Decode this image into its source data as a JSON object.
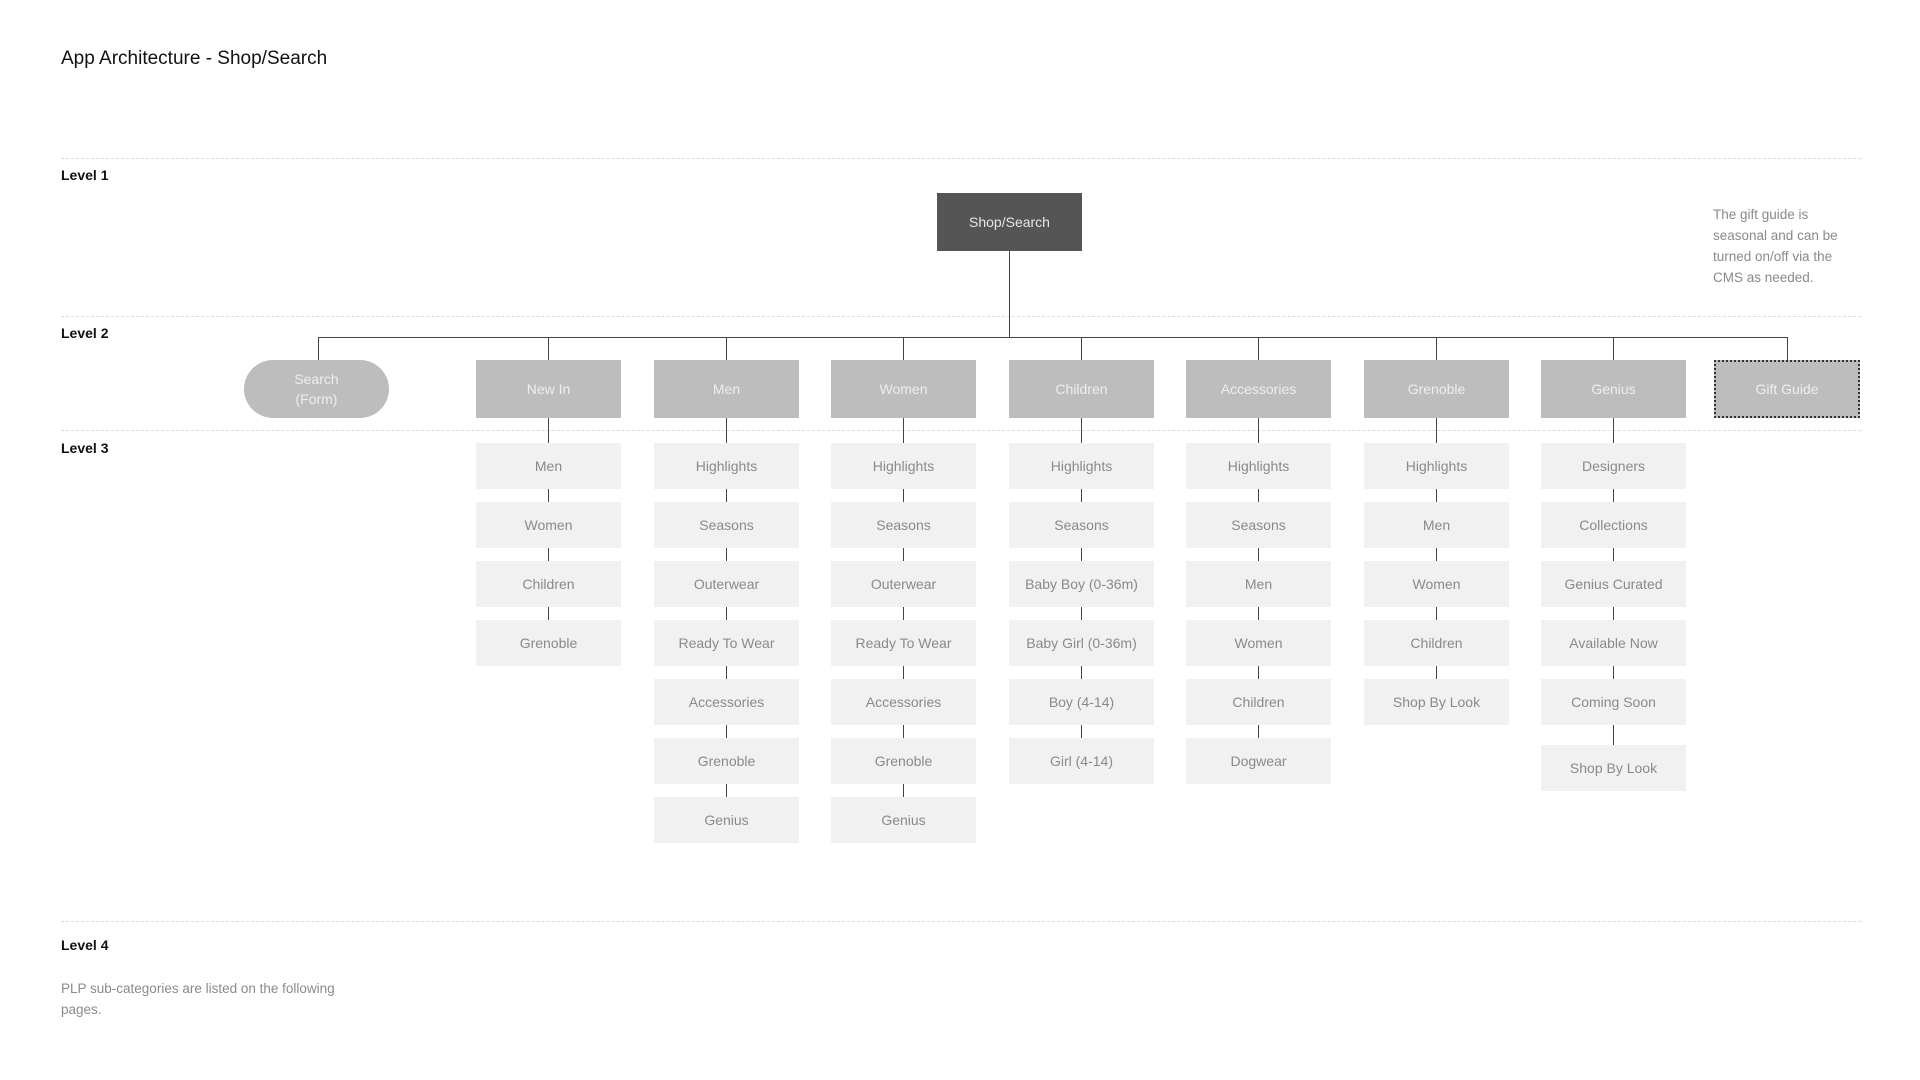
{
  "page_title": "App Architecture - Shop/Search",
  "levels": [
    "Level 1",
    "Level 2",
    "Level 3",
    "Level 4"
  ],
  "root": "Shop/Search",
  "gift_note": [
    "The gift guide is",
    "seasonal and can be",
    "turned on/off via the",
    "CMS as needed."
  ],
  "level4_note": [
    "PLP sub-categories are listed on the following",
    "pages."
  ],
  "search": [
    "Search",
    "(Form)"
  ],
  "columns": [
    {
      "label": "New In",
      "children": [
        "Men",
        "Women",
        "Children",
        "Grenoble"
      ]
    },
    {
      "label": "Men",
      "children": [
        "Highlights",
        "Seasons",
        "Outerwear",
        "Ready To Wear",
        "Accessories",
        "Grenoble",
        "Genius"
      ]
    },
    {
      "label": "Women",
      "children": [
        "Highlights",
        "Seasons",
        "Outerwear",
        "Ready To Wear",
        "Accessories",
        "Grenoble",
        "Genius"
      ]
    },
    {
      "label": "Children",
      "children": [
        "Highlights",
        "Seasons",
        "Baby Boy (0-36m)",
        "Baby Girl (0-36m)",
        "Boy (4-14)",
        "Girl (4-14)"
      ]
    },
    {
      "label": "Accessories",
      "children": [
        "Highlights",
        "Seasons",
        "Men",
        "Women",
        "Children",
        "Dogwear"
      ]
    },
    {
      "label": "Grenoble",
      "children": [
        "Highlights",
        "Men",
        "Women",
        "Children",
        "Shop By Look"
      ]
    },
    {
      "label": "Genius",
      "children": [
        "Designers",
        "Collections",
        "Genius Curated",
        "Available Now",
        "Coming Soon",
        "Shop By Look"
      ]
    }
  ],
  "gift_guide": "Gift Guide",
  "colors": {
    "root": "#555555",
    "level2": "#bdbdbd",
    "level3": "#f1f1f1",
    "connector": "#444444"
  }
}
